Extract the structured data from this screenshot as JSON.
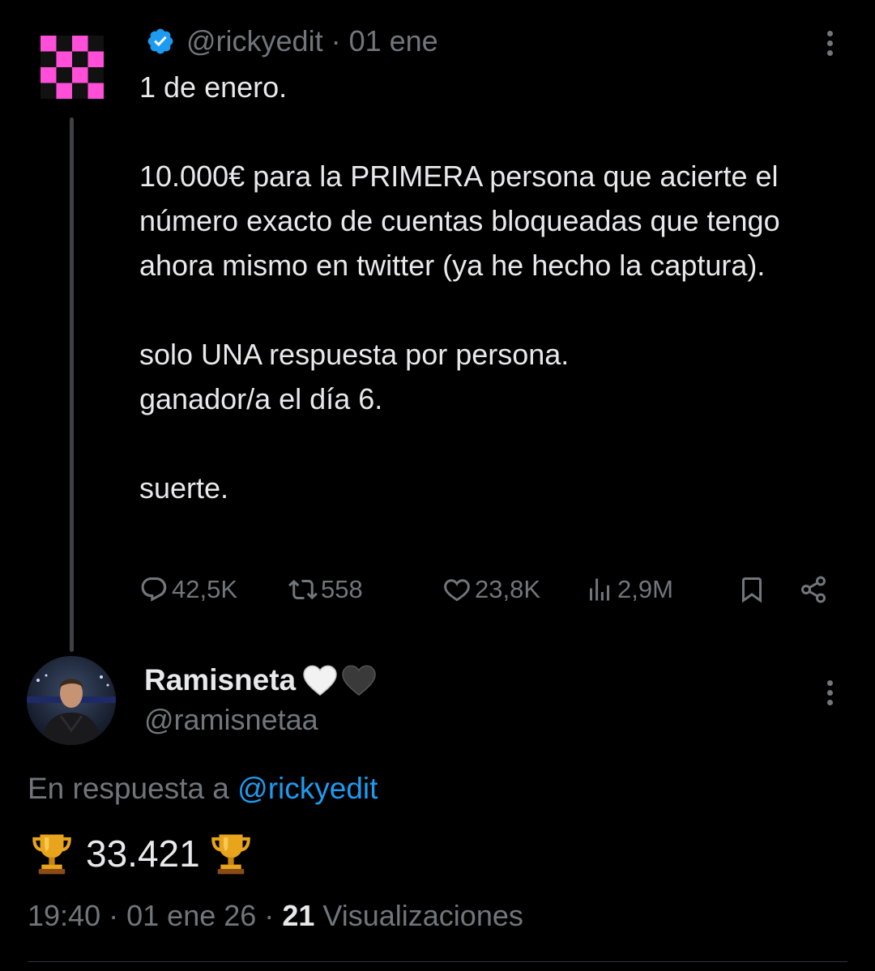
{
  "parent_tweet": {
    "handle": "@rickyedit",
    "separator": "·",
    "date": "01 ene",
    "avatar": "pink-checker-logo",
    "body": {
      "line1": "1 de enero.",
      "para2": "10.000€ para la PRIMERA persona que acierte el número exacto de cuentas bloqueadas que tengo ahora mismo en twitter (ya he hecho la captura).",
      "para3_line1": "solo UNA respuesta por persona.",
      "para3_line2": "ganador/a el día 6.",
      "para4": "suerte."
    },
    "actions": {
      "replies": "42,5K",
      "retweets": "558",
      "likes": "23,8K",
      "views": "2,9M"
    }
  },
  "reply_tweet": {
    "display_name": "Ramisneta",
    "name_emojis": [
      "white-heart",
      "black-heart"
    ],
    "handle": "@ramisnetaa",
    "in_reply_prefix": "En respuesta a",
    "in_reply_mention": "@rickyedit",
    "text": "33.421",
    "text_emoji": "trophy",
    "time": "19:40",
    "separator": "·",
    "date": "01 ene 26",
    "view_count": "21",
    "view_label": "Visualizaciones"
  },
  "colors": {
    "background": "#000000",
    "text_primary": "#e7e9ea",
    "text_secondary": "#71767b",
    "link": "#1d9bf0",
    "verified": "#1d9bf0",
    "avatar_pink": "#ff4fd8"
  }
}
